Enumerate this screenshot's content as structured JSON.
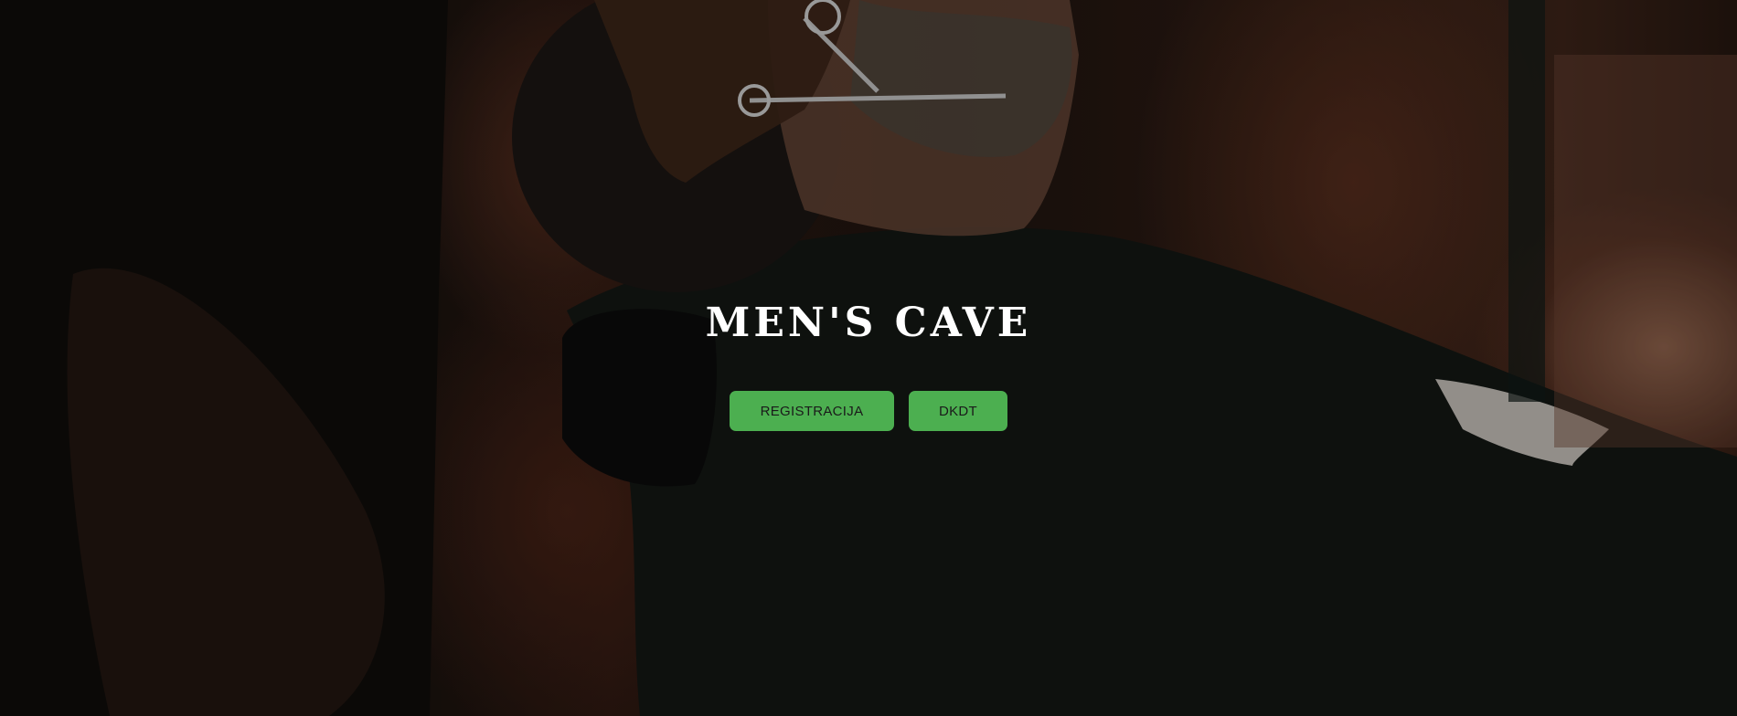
{
  "hero": {
    "title": "MEN'S CAVE",
    "background_description_icon": "barber-photo",
    "buttons": {
      "register_label": "REGISTRACIJA",
      "dkdt_label": "DKDT"
    }
  },
  "colors": {
    "button_bg": "#4caf50",
    "button_text": "#1a1a1a",
    "title_text": "#ffffff"
  }
}
